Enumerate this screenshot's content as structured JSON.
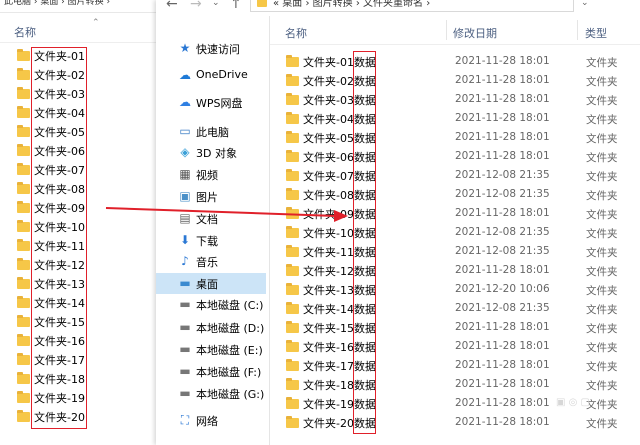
{
  "left_window": {
    "breadcrumb": "此电脑 › 桌面 › 图片转换 ›",
    "column_header": "名称",
    "items": [
      "文件夹-01",
      "文件夹-02",
      "文件夹-03",
      "文件夹-04",
      "文件夹-05",
      "文件夹-06",
      "文件夹-07",
      "文件夹-08",
      "文件夹-09",
      "文件夹-10",
      "文件夹-11",
      "文件夹-12",
      "文件夹-13",
      "文件夹-14",
      "文件夹-15",
      "文件夹-16",
      "文件夹-17",
      "文件夹-18",
      "文件夹-19",
      "文件夹-20"
    ]
  },
  "right_window": {
    "address": "«  桌面  ›  图片转换  ›  文件夹重命名  ›",
    "nav_arrows": {
      "back": "←",
      "forward": "→",
      "dropdown": "⌄",
      "up": "↑"
    },
    "nav_pane": [
      {
        "label": "快速访问",
        "icon": "star-icon",
        "glyph": "★",
        "color": "#2b78d4"
      },
      {
        "label": "OneDrive",
        "icon": "cloud-icon",
        "glyph": "☁",
        "color": "#1e7ad6"
      },
      {
        "label": "WPS网盘",
        "icon": "cloud-icon",
        "glyph": "☁",
        "color": "#2f7fe2"
      },
      {
        "label": "此电脑",
        "icon": "computer-icon",
        "glyph": "▭",
        "color": "#3a7cc4"
      },
      {
        "label": "3D 对象",
        "icon": "cube-icon",
        "glyph": "◈",
        "color": "#3aa0d8"
      },
      {
        "label": "视频",
        "icon": "video-icon",
        "glyph": "▦",
        "color": "#555"
      },
      {
        "label": "图片",
        "icon": "picture-icon",
        "glyph": "▣",
        "color": "#4a90c8"
      },
      {
        "label": "文档",
        "icon": "document-icon",
        "glyph": "▤",
        "color": "#666"
      },
      {
        "label": "下载",
        "icon": "download-icon",
        "glyph": "⬇",
        "color": "#2b78d4"
      },
      {
        "label": "音乐",
        "icon": "music-icon",
        "glyph": "♪",
        "color": "#2b78d4"
      },
      {
        "label": "桌面",
        "icon": "desktop-icon",
        "glyph": "▬",
        "color": "#3a8ad0"
      },
      {
        "label": "本地磁盘 (C:)",
        "icon": "drive-icon",
        "glyph": "▬",
        "color": "#777"
      },
      {
        "label": "本地磁盘 (D:)",
        "icon": "drive-icon",
        "glyph": "▬",
        "color": "#777"
      },
      {
        "label": "本地磁盘 (E:)",
        "icon": "drive-icon",
        "glyph": "▬",
        "color": "#777"
      },
      {
        "label": "本地磁盘 (F:)",
        "icon": "drive-icon",
        "glyph": "▬",
        "color": "#777"
      },
      {
        "label": "本地磁盘 (G:)",
        "icon": "drive-icon",
        "glyph": "▬",
        "color": "#777"
      },
      {
        "label": "网络",
        "icon": "network-icon",
        "glyph": "⛶",
        "color": "#2b78d4"
      }
    ],
    "selected_nav_index": 10,
    "columns": {
      "name": "名称",
      "date": "修改日期",
      "type": "类型"
    },
    "files": [
      {
        "name": "文件夹-01数据",
        "date": "2021-11-28 18:01",
        "type": "文件夹"
      },
      {
        "name": "文件夹-02数据",
        "date": "2021-11-28 18:01",
        "type": "文件夹"
      },
      {
        "name": "文件夹-03数据",
        "date": "2021-11-28 18:01",
        "type": "文件夹"
      },
      {
        "name": "文件夹-04数据",
        "date": "2021-11-28 18:01",
        "type": "文件夹"
      },
      {
        "name": "文件夹-05数据",
        "date": "2021-11-28 18:01",
        "type": "文件夹"
      },
      {
        "name": "文件夹-06数据",
        "date": "2021-11-28 18:01",
        "type": "文件夹"
      },
      {
        "name": "文件夹-07数据",
        "date": "2021-12-08 21:35",
        "type": "文件夹"
      },
      {
        "name": "文件夹-08数据",
        "date": "2021-12-08 21:35",
        "type": "文件夹"
      },
      {
        "name": "文件夹-09数据",
        "date": "2021-11-28 18:01",
        "type": "文件夹"
      },
      {
        "name": "文件夹-10数据",
        "date": "2021-12-08 21:35",
        "type": "文件夹"
      },
      {
        "name": "文件夹-11数据",
        "date": "2021-12-08 21:35",
        "type": "文件夹"
      },
      {
        "name": "文件夹-12数据",
        "date": "2021-11-28 18:01",
        "type": "文件夹"
      },
      {
        "name": "文件夹-13数据",
        "date": "2021-12-20 10:06",
        "type": "文件夹"
      },
      {
        "name": "文件夹-14数据",
        "date": "2021-12-08 21:35",
        "type": "文件夹"
      },
      {
        "name": "文件夹-15数据",
        "date": "2021-11-28 18:01",
        "type": "文件夹"
      },
      {
        "name": "文件夹-16数据",
        "date": "2021-11-28 18:01",
        "type": "文件夹"
      },
      {
        "name": "文件夹-17数据",
        "date": "2021-11-28 18:01",
        "type": "文件夹"
      },
      {
        "name": "文件夹-18数据",
        "date": "2021-11-28 18:01",
        "type": "文件夹"
      },
      {
        "name": "文件夹-19数据",
        "date": "2021-11-28 18:01",
        "type": "文件夹"
      },
      {
        "name": "文件夹-20数据",
        "date": "2021-11-28 18:01",
        "type": "文件夹"
      }
    ]
  },
  "colors": {
    "annotation_red": "#e0202a",
    "folder_yellow": "#f6c748",
    "header_text": "#4d6082",
    "selected_bg": "#cce4f7"
  }
}
